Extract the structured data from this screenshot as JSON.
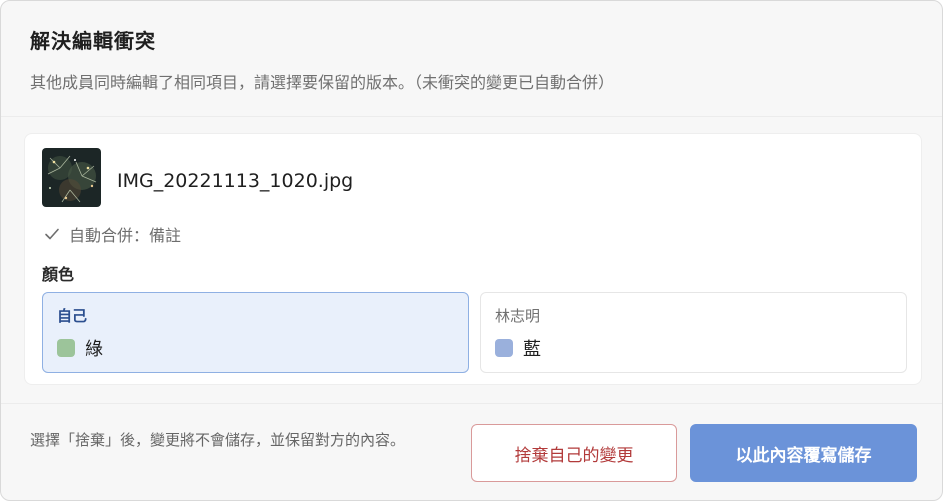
{
  "dialog": {
    "title": "解決編輯衝突",
    "subtitle": "其他成員同時編輯了相同項目，請選擇要保留的版本。（未衝突的變更已自動合併）"
  },
  "item": {
    "file_name": "IMG_20221113_1020.jpg",
    "thumbnail_icon": "photo-thumbnail",
    "auto_merge_label": "自動合併：備註"
  },
  "conflict": {
    "field_label": "顏色",
    "mine": {
      "owner": "自己",
      "value": "綠",
      "swatch_color": "#9cc49a",
      "selected": true
    },
    "theirs": {
      "owner": "林志明",
      "value": "藍",
      "swatch_color": "#9ab0dc",
      "selected": false
    }
  },
  "footer": {
    "note": "選擇「捨棄」後，變更將不會儲存，並保留對方的內容。",
    "discard_label": "捨棄自己的變更",
    "save_label": "以此內容覆寫儲存"
  },
  "colors": {
    "accent": "#6b93d9",
    "danger": "#b23a3a",
    "selected_bg": "#e9f0fb"
  }
}
